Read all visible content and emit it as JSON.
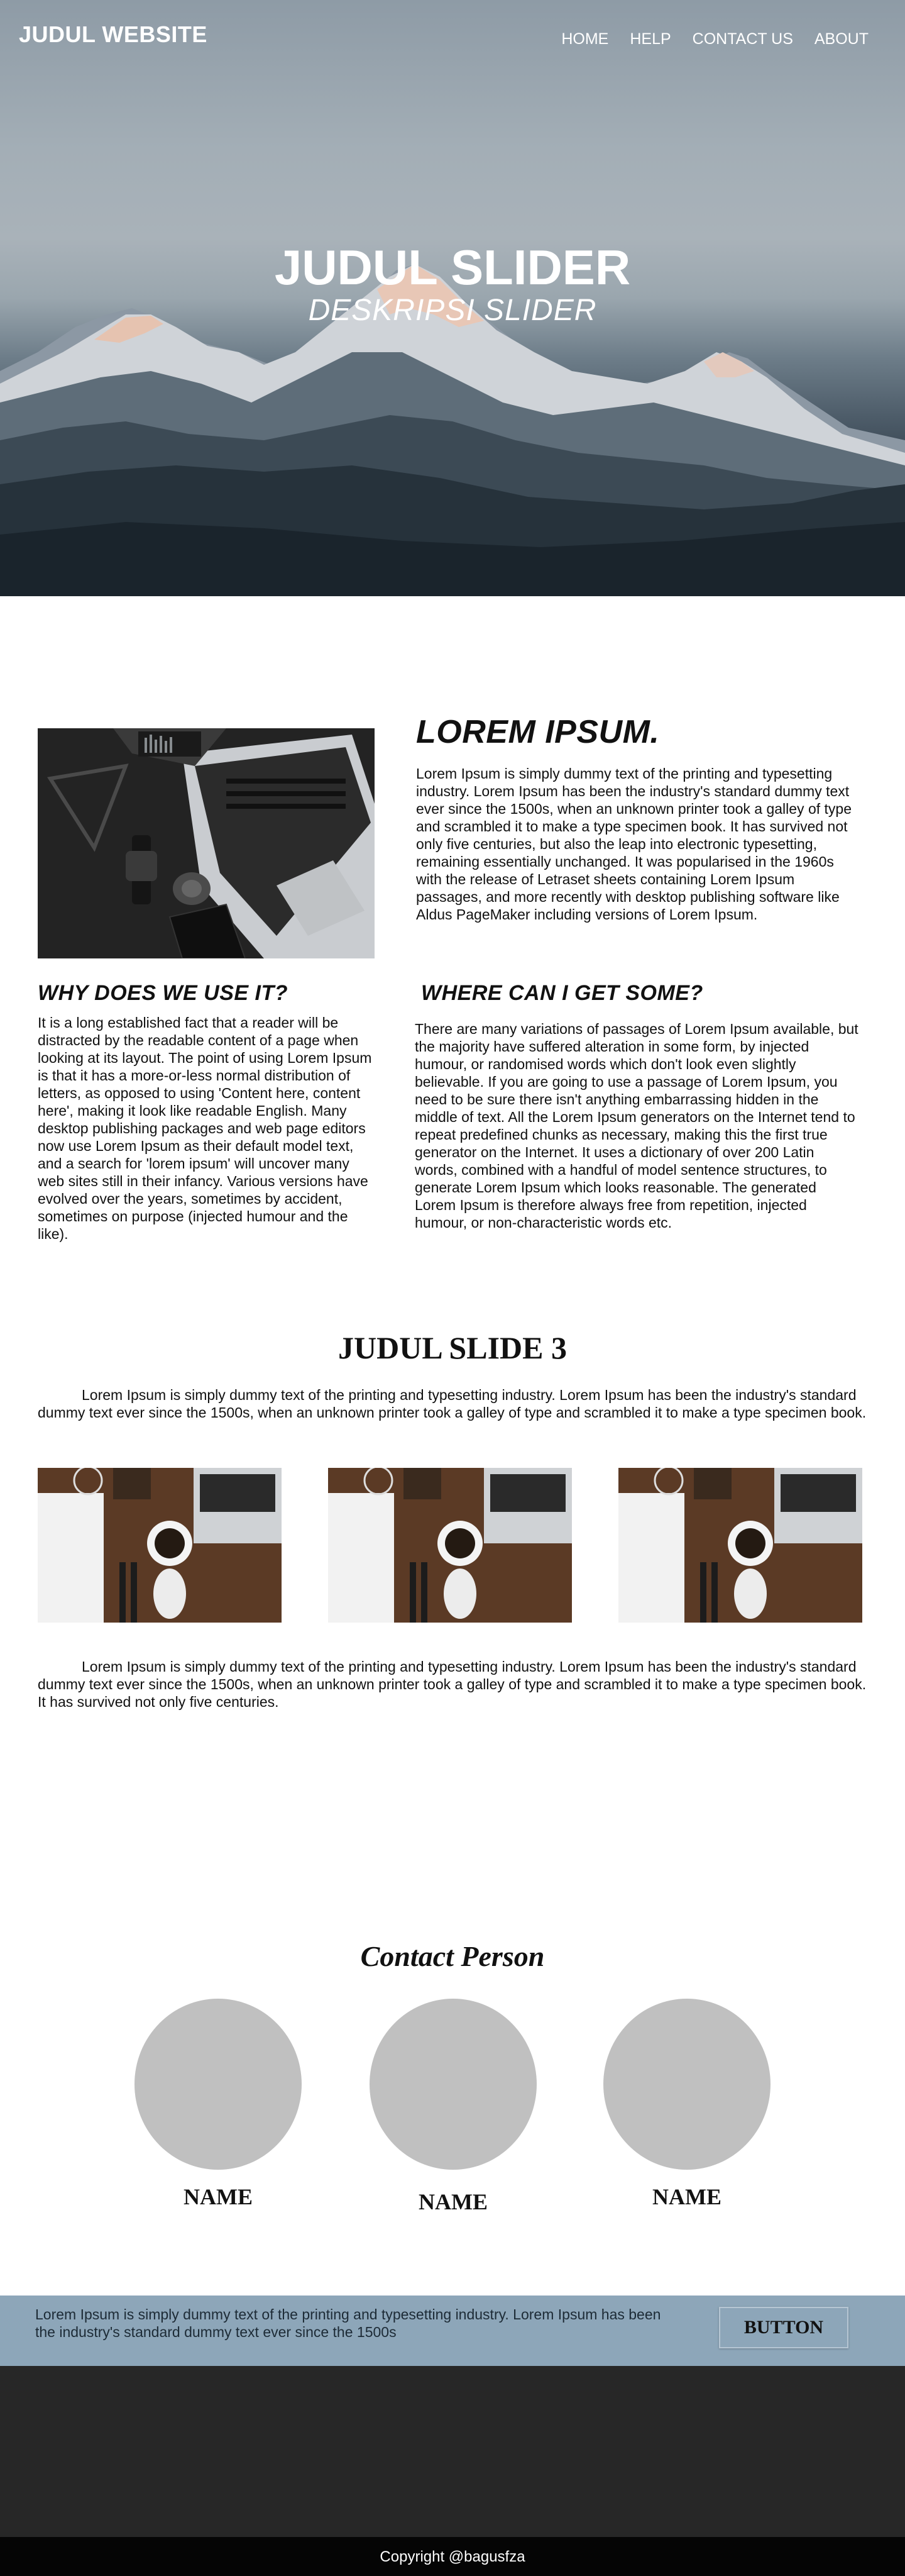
{
  "header": {
    "site_title": "JUDUL WEBSITE",
    "nav": [
      "HOME",
      "HELP",
      "CONTACT US",
      "ABOUT"
    ]
  },
  "hero": {
    "title": "JUDUL SLIDER",
    "description": "DESKRIPSI SLIDER"
  },
  "about": {
    "lorem_title": "LOREM IPSUM.",
    "lorem_text": "Lorem Ipsum is simply dummy text of the printing and typesetting industry. Lorem Ipsum has been the industry's standard dummy text ever since the 1500s, when an unknown printer took a galley of type and scrambled it to make a type specimen book. It has survived not only five centuries, but also the leap into electronic typesetting, remaining essentially unchanged. It was popularised in the 1960s with the release of Letraset sheets containing Lorem Ipsum passages, and more recently with desktop publishing software like Aldus PageMaker including versions of Lorem Ipsum.",
    "why_title": "WHY DOES WE USE IT?",
    "why_text": "It is a long established fact that a reader will be distracted by the readable content of a page when looking at its layout. The point of using Lorem Ipsum is that it has a more-or-less normal distribution of letters, as opposed to using 'Content here, content here', making it look like readable English. Many desktop publishing packages and web page editors now use Lorem Ipsum as their default model text, and a search for 'lorem ipsum' will uncover many web sites still in their infancy. Various versions have evolved over the years, sometimes by accident, sometimes on purpose (injected humour and the like).",
    "where_title": "WHERE CAN I GET SOME?",
    "where_text": "There are many variations of passages of Lorem Ipsum available, but the majority have suffered alteration in some form, by injected humour, or randomised words which don't look even slightly believable. If you are going to use a passage of Lorem Ipsum, you need to be sure there isn't anything embarrassing hidden in the middle of text. All the Lorem Ipsum generators on the Internet tend to repeat predefined chunks as necessary, making this the first true generator on the Internet. It uses a dictionary of over 200 Latin words, combined with a handful of model sentence structures, to generate Lorem Ipsum which looks reasonable. The generated Lorem Ipsum is therefore always free from repetition, injected humour, or non-characteristic words etc."
  },
  "slide3": {
    "title": "JUDUL SLIDE 3",
    "text": "Lorem Ipsum is simply dummy text of the printing and typesetting industry. Lorem Ipsum has been the industry's standard dummy text ever since the 1500s, when an unknown printer took a galley of type and scrambled it to make a type specimen book.",
    "text2": "Lorem Ipsum is simply dummy text of the printing and typesetting industry. Lorem Ipsum has been the industry's standard dummy text ever since the 1500s, when an unknown printer took a galley of type and scrambled it to make a type specimen book. It has survived not only five centuries."
  },
  "contact": {
    "title": "Contact Person",
    "names": [
      "NAME",
      "NAME",
      "NAME"
    ]
  },
  "cta": {
    "text": "Lorem Ipsum is simply dummy text of the printing and typesetting industry. Lorem Ipsum has been the industry's standard dummy text ever since the 1500s",
    "button_label": "BUTTON"
  },
  "footer": {
    "copyright": "Copyright @bagusfza"
  },
  "colors": {
    "cta_background": "#8da6b9",
    "footer_dark": "#272727",
    "footer_bar": "#050505",
    "avatar_gray": "#c0c0c0"
  }
}
